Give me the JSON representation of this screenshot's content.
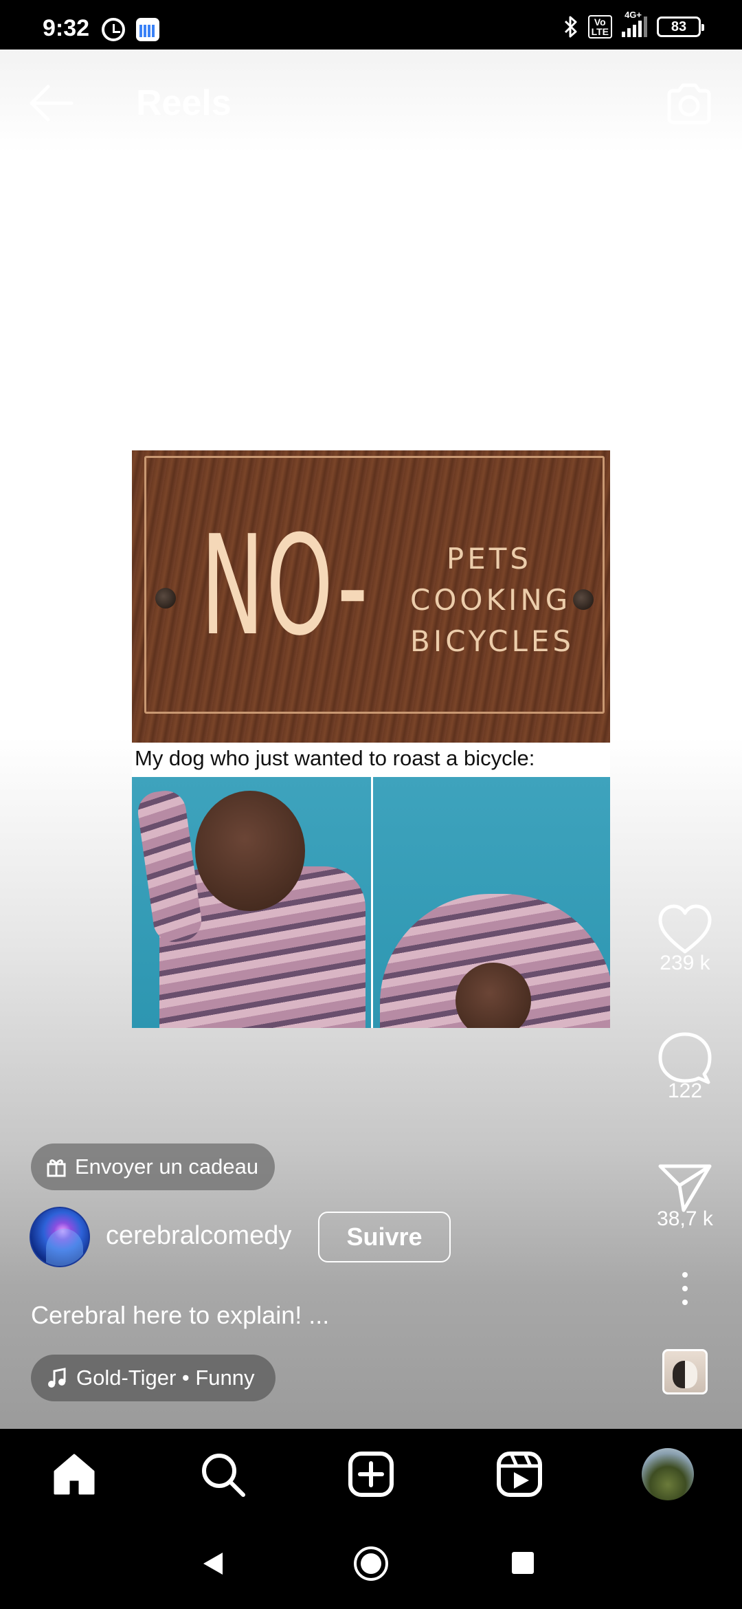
{
  "status_bar": {
    "time": "9:32",
    "network": "4G+",
    "volte": "Vo LTE",
    "battery": "83"
  },
  "header": {
    "title": "Reels"
  },
  "post": {
    "meme_sign_big": "NO-",
    "meme_sign_words": [
      "PETS",
      "COOKING",
      "BICYCLES"
    ],
    "meme_caption": "My dog who just wanted to roast a bicycle:"
  },
  "actions": {
    "likes": "239 k",
    "comments": "122",
    "shares": "38,7 k"
  },
  "info": {
    "gift_label": "Envoyer un cadeau",
    "username": "cerebralcomedy",
    "follow_label": "Suivre",
    "caption": "Cerebral here to explain! ...",
    "music": "Gold-Tiger • Funny"
  },
  "colors": {
    "background": "#ffffff",
    "nav_background": "#000000",
    "text_on_overlay": "#ffffff"
  },
  "icons": {
    "back": "arrow-left-icon",
    "camera": "camera-icon",
    "like": "heart-icon",
    "comment": "comment-bubble-icon",
    "share": "paper-plane-icon",
    "more": "more-vertical-icon",
    "nav": [
      "home-icon",
      "search-icon",
      "plus-square-icon",
      "reels-icon",
      "profile-avatar"
    ]
  }
}
